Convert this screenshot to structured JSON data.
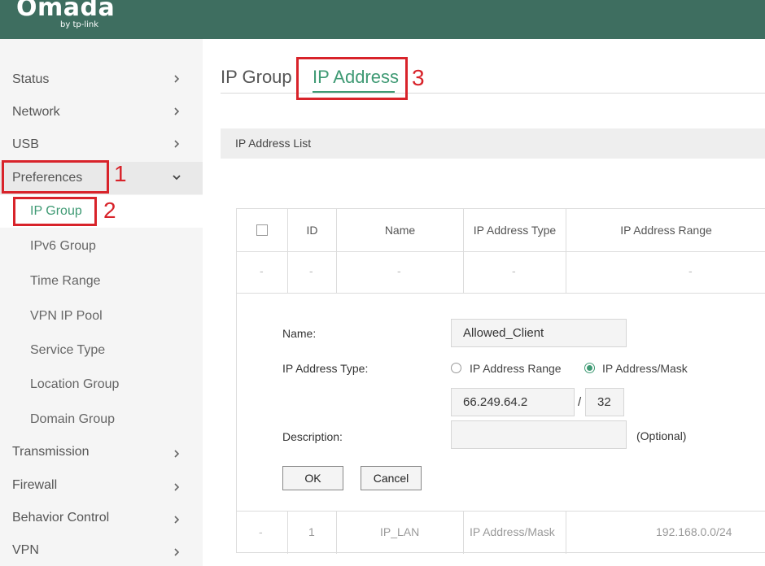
{
  "header": {
    "logo": "Omada",
    "logo_sub": "by tp-link",
    "bg_color": "#3e6e60"
  },
  "sidebar": {
    "items": [
      {
        "label": "Status",
        "icon": "chevron-right-icon"
      },
      {
        "label": "Network",
        "icon": "chevron-right-icon"
      },
      {
        "label": "USB",
        "icon": "chevron-right-icon"
      },
      {
        "label": "Preferences",
        "icon": "chevron-down-icon",
        "expanded": true
      },
      {
        "label": "Transmission",
        "icon": "chevron-right-icon"
      },
      {
        "label": "Firewall",
        "icon": "chevron-right-icon"
      },
      {
        "label": "Behavior Control",
        "icon": "chevron-right-icon"
      },
      {
        "label": "VPN",
        "icon": "chevron-right-icon"
      }
    ],
    "preferences_sub": [
      "IP Group",
      "IPv6 Group",
      "Time Range",
      "VPN IP Pool",
      "Service Type",
      "Location Group",
      "Domain Group"
    ],
    "selected_sub": "IP Group"
  },
  "tabs": [
    {
      "label": "IP Group",
      "active": false
    },
    {
      "label": "IP Address",
      "active": true
    }
  ],
  "section": {
    "title": "IP Address List"
  },
  "table": {
    "columns": [
      "ID",
      "Name",
      "IP Address Type",
      "IP Address Range"
    ],
    "placeholder": "-",
    "rows": [
      {
        "select": "-",
        "id": "1",
        "name": "IP_LAN",
        "type": "IP Address/Mask",
        "range": "192.168.0.0/24"
      }
    ]
  },
  "form": {
    "name_label": "Name:",
    "name_value": "Allowed_Client",
    "type_label": "IP Address Type:",
    "radio_range": "IP Address Range",
    "radio_mask": "IP Address/Mask",
    "selected_type": "IP Address/Mask",
    "ip_value": "66.249.64.2",
    "slash": "/",
    "mask_value": "32",
    "description_label": "Description:",
    "description_value": "",
    "optional_hint": "(Optional)",
    "ok_label": "OK",
    "cancel_label": "Cancel"
  },
  "annotations": [
    "1",
    "2",
    "3"
  ],
  "colors": {
    "accent": "#3f9a74",
    "annotation": "#d8232a"
  }
}
